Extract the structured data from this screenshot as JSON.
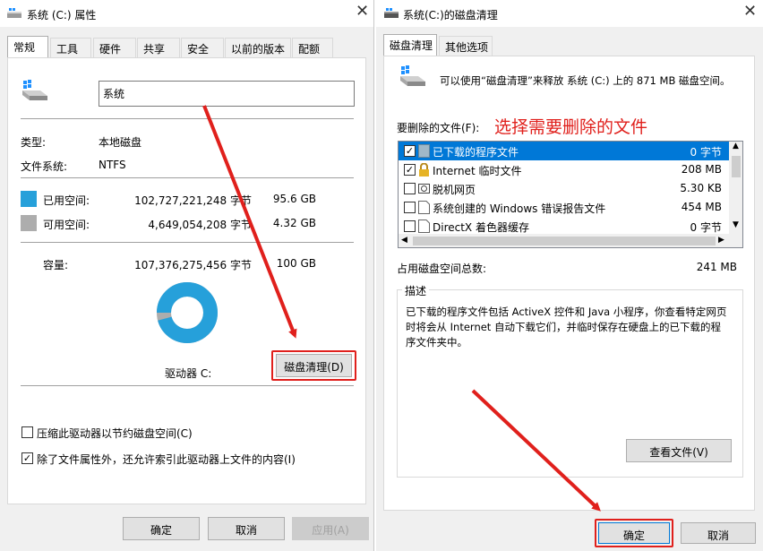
{
  "left_window": {
    "title": "系统 (C:) 属性",
    "tabs": [
      "常规",
      "工具",
      "硬件",
      "共享",
      "安全",
      "以前的版本",
      "配额"
    ],
    "active_tab": 0,
    "drive_name_value": "系统",
    "type_label": "类型:",
    "type_value": "本地磁盘",
    "fs_label": "文件系统:",
    "fs_value": "NTFS",
    "used_label": "已用空间:",
    "used_bytes": "102,727,221,248 字节",
    "used_gb": "95.6 GB",
    "free_label": "可用空间:",
    "free_bytes": "4,649,054,208 字节",
    "free_gb": "4.32 GB",
    "capacity_label": "容量:",
    "capacity_bytes": "107,376,275,456 字节",
    "capacity_gb": "100 GB",
    "drive_label": "驱动器 C:",
    "cleanup_button": "磁盘清理(D)",
    "compress_label": "压缩此驱动器以节约磁盘空间(C)",
    "compress_checked": false,
    "index_label": "除了文件属性外，还允许索引此驱动器上文件的内容(I)",
    "index_checked": true,
    "ok_button": "确定",
    "cancel_button": "取消",
    "apply_button": "应用(A)",
    "used_fraction": 0.957,
    "colors": {
      "used": "#26a0da",
      "free": "#adadad"
    }
  },
  "right_window": {
    "title": "系统(C:)的磁盘清理",
    "tabs": [
      "磁盘清理",
      "其他选项"
    ],
    "active_tab": 0,
    "header_text": "可以使用“磁盘清理”来释放 系统 (C:) 上的 871 MB 磁盘空间。",
    "files_label": "要删除的文件(F):",
    "annotation": "选择需要删除的文件",
    "files": [
      {
        "name": "已下载的程序文件",
        "size": "0 字节",
        "checked": true,
        "selected": true,
        "icon": "folder-icon"
      },
      {
        "name": "Internet 临时文件",
        "size": "208 MB",
        "checked": true,
        "selected": false,
        "icon": "lock-icon"
      },
      {
        "name": "脱机网页",
        "size": "5.30 KB",
        "checked": false,
        "selected": false,
        "icon": "offline-pages-icon"
      },
      {
        "name": "系统创建的 Windows 错误报告文件",
        "size": "454 MB",
        "checked": false,
        "selected": false,
        "icon": "file-icon"
      },
      {
        "name": "DirectX 着色器缓存",
        "size": "0 字节",
        "checked": false,
        "selected": false,
        "icon": "file-icon"
      }
    ],
    "total_label": "占用磁盘空间总数:",
    "total_value": "241 MB",
    "description_title": "描述",
    "description_text": "已下载的程序文件包括 ActiveX 控件和 Java 小程序，你查看特定网页时将会从 Internet 自动下载它们，并临时保存在硬盘上的已下载的程序文件夹中。",
    "view_files_button": "查看文件(V)",
    "ok_button": "确定",
    "cancel_button": "取消",
    "colors": {
      "selection": "#0078d7",
      "annotation": "#e0201c"
    }
  }
}
